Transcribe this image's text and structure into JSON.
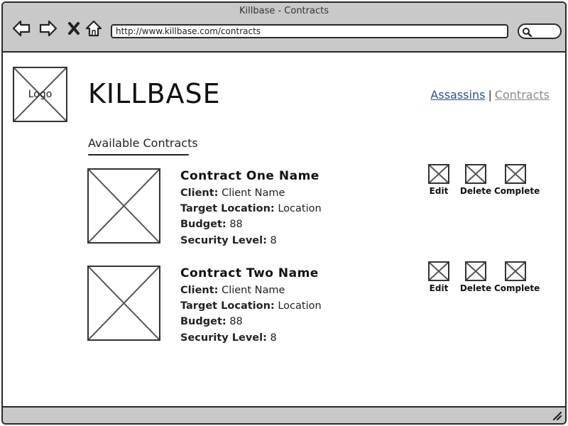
{
  "window": {
    "title": "Killbase - Contracts"
  },
  "browser": {
    "url": "http://www.killbase.com/contracts",
    "buttons": {
      "back": "back-arrow-icon",
      "forward": "forward-arrow-icon",
      "stop": "close-icon",
      "home": "home-icon",
      "search": "search-icon"
    }
  },
  "header": {
    "logo_label": "Logo",
    "site_title": "KILLBASE",
    "nav": [
      {
        "label": "Assassins",
        "active": false
      },
      {
        "label": "Contracts",
        "active": true
      }
    ],
    "nav_separator": "|"
  },
  "section": {
    "heading": "Available Contracts"
  },
  "labels": {
    "client": "Client:",
    "location": "Target Location:",
    "budget": "Budget:",
    "security": "Security Level:"
  },
  "contracts": [
    {
      "name": "Contract One Name",
      "client": "Client Name",
      "location": "Location",
      "budget": "88",
      "security": "8",
      "actions": [
        "Edit",
        "Delete",
        "Complete"
      ]
    },
    {
      "name": "Contract Two Name",
      "client": "Client Name",
      "location": "Location",
      "budget": "88",
      "security": "8",
      "actions": [
        "Edit",
        "Delete",
        "Complete"
      ]
    }
  ],
  "colors": {
    "chrome": "#c9c9c9",
    "link": "#2b4f8c",
    "link_inactive": "#8a8a8a"
  }
}
